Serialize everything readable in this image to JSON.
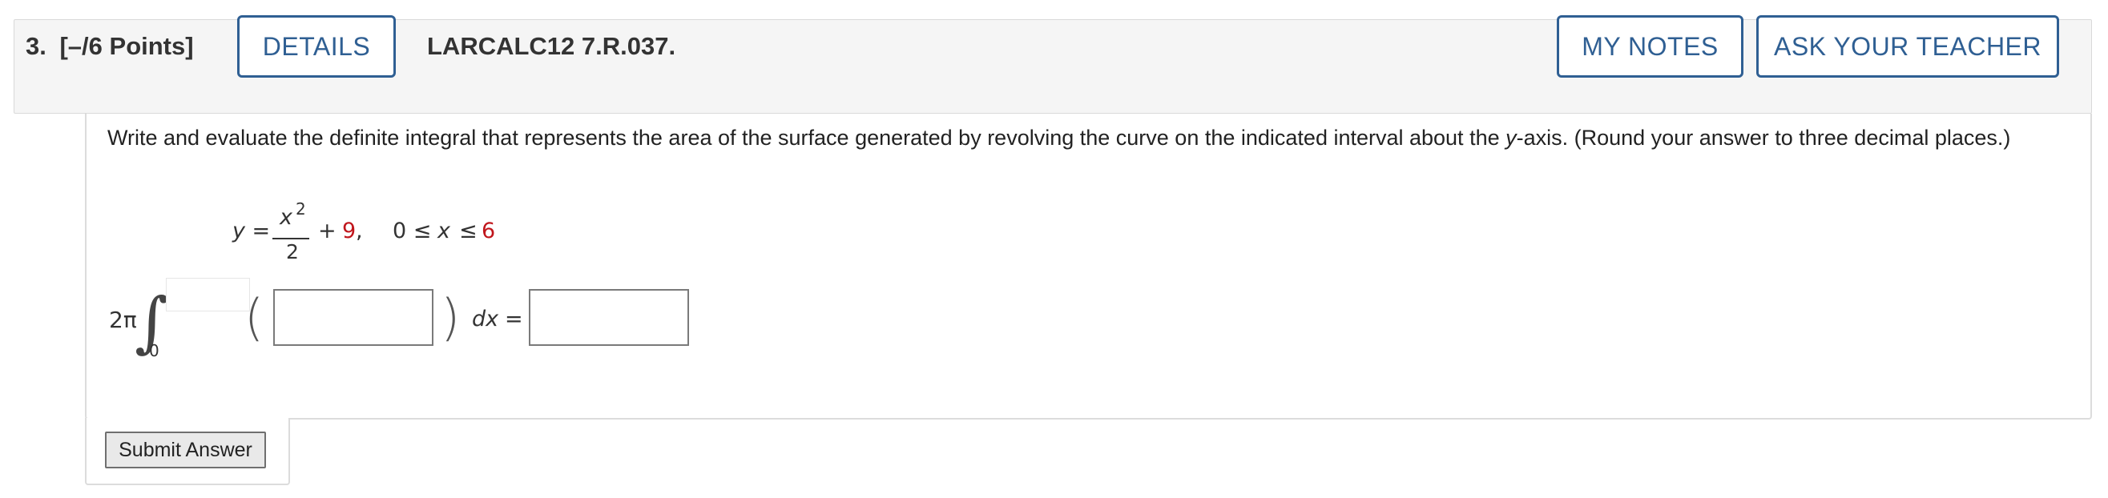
{
  "header": {
    "question_number": "3.",
    "points": "[–/6 Points]",
    "details_label": "DETAILS",
    "problem_code": "LARCALC12 7.R.037.",
    "my_notes_label": "MY NOTES",
    "ask_teacher_label": "ASK YOUR TEACHER",
    "accent_color": "#2f5f93"
  },
  "question": {
    "prompt_before": "Write and evaluate the definite integral that represents the area of the surface generated by revolving the curve on the indicated interval about the ",
    "prompt_var": "y",
    "prompt_after": "-axis. (Round your answer to three decimal places.)",
    "equation": {
      "lhs": "y =",
      "numerator_var": "x",
      "exponent": "2",
      "denominator": "2",
      "plus": "+",
      "constant": "9",
      "comma": ",",
      "interval_start": "0 ≤",
      "interval_var": "x",
      "interval_le": "≤",
      "interval_end": "6"
    },
    "integral": {
      "coefficient": "2π",
      "integral_sign": "∫",
      "lower_limit": "0",
      "upper_limit_value": "",
      "open_paren": "(",
      "close_paren": ")",
      "integrand_value": "",
      "differential": "dx",
      "equals": "=",
      "result_value": ""
    },
    "submit_label": "Submit Answer"
  }
}
